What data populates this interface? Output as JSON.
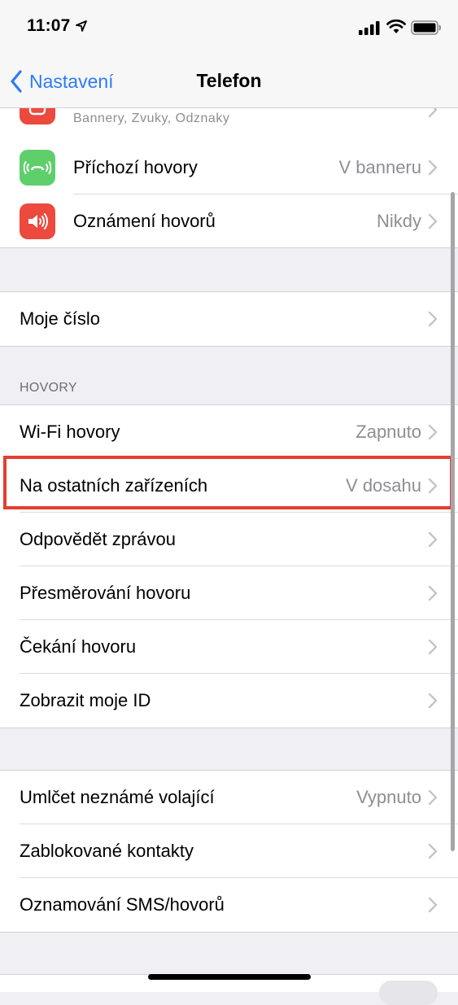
{
  "status_bar": {
    "time": "11:07"
  },
  "nav": {
    "back_label": "Nastavení",
    "title": "Telefon"
  },
  "notifications_group": {
    "partial_subtitle": "Bannery, Zvuky, Odznaky",
    "incoming_calls": {
      "label": "Příchozí hovory",
      "value": "V banneru"
    },
    "announce_calls": {
      "label": "Oznámení hovorů",
      "value": "Nikdy"
    }
  },
  "my_number": {
    "label": "Moje číslo"
  },
  "calls_section": {
    "header": "HOVORY",
    "items": [
      {
        "label": "Wi-Fi hovory",
        "value": "Zapnuto"
      },
      {
        "label": "Na ostatních zařízeních",
        "value": "V dosahu"
      },
      {
        "label": "Odpovědět zprávou",
        "value": ""
      },
      {
        "label": "Přesměrování hovoru",
        "value": ""
      },
      {
        "label": "Čekání hovoru",
        "value": ""
      },
      {
        "label": "Zobrazit moje ID",
        "value": ""
      }
    ]
  },
  "blocking_section": {
    "items": [
      {
        "label": "Umlčet neznámé volající",
        "value": "Vypnuto"
      },
      {
        "label": "Zablokované kontakty",
        "value": ""
      },
      {
        "label": "Oznamování SMS/hovorů",
        "value": ""
      }
    ]
  },
  "colors": {
    "accent": "#2b7cf6",
    "green_icon": "#5fcf6c",
    "red_icon": "#ec4a3e",
    "highlight": "#e43f2e"
  }
}
